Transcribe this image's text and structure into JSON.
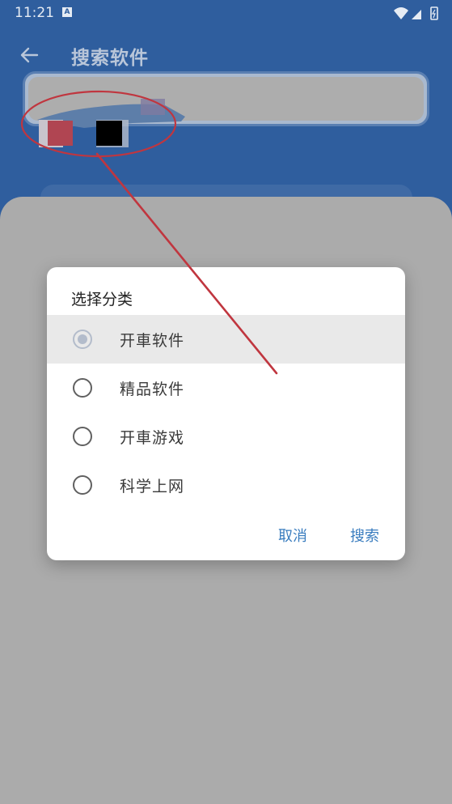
{
  "status_bar": {
    "time": "11:21",
    "notification_icon": "A"
  },
  "app_bar": {
    "title": "搜索软件",
    "back_icon": "arrow-left"
  },
  "dialog": {
    "title": "选择分类",
    "options": [
      {
        "label": "开車软件",
        "selected": true
      },
      {
        "label": "精品软件",
        "selected": false
      },
      {
        "label": "开車游戏",
        "selected": false
      },
      {
        "label": "科学上网",
        "selected": false
      }
    ],
    "cancel_label": "取消",
    "search_label": "搜索"
  },
  "colors": {
    "app_bar": "#2f5e9e",
    "accent": "#3a7dbf",
    "scrim_bg": "#ababab",
    "annotation": "#c0363f"
  }
}
